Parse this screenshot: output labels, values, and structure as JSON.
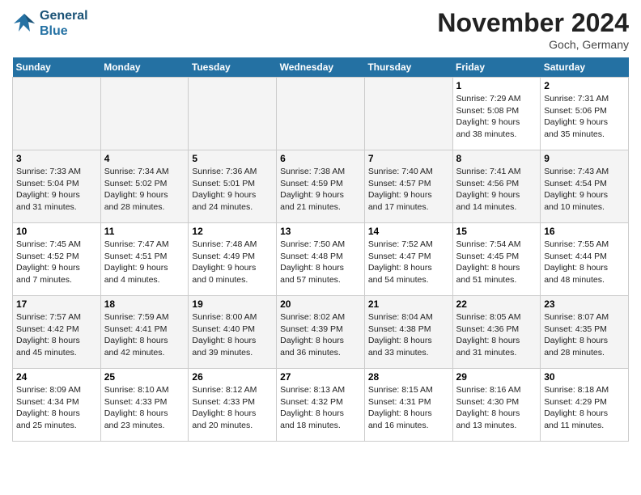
{
  "header": {
    "logo_line1": "General",
    "logo_line2": "Blue",
    "month": "November 2024",
    "location": "Goch, Germany"
  },
  "weekdays": [
    "Sunday",
    "Monday",
    "Tuesday",
    "Wednesday",
    "Thursday",
    "Friday",
    "Saturday"
  ],
  "weeks": [
    [
      {
        "day": "",
        "info": ""
      },
      {
        "day": "",
        "info": ""
      },
      {
        "day": "",
        "info": ""
      },
      {
        "day": "",
        "info": ""
      },
      {
        "day": "",
        "info": ""
      },
      {
        "day": "1",
        "info": "Sunrise: 7:29 AM\nSunset: 5:08 PM\nDaylight: 9 hours\nand 38 minutes."
      },
      {
        "day": "2",
        "info": "Sunrise: 7:31 AM\nSunset: 5:06 PM\nDaylight: 9 hours\nand 35 minutes."
      }
    ],
    [
      {
        "day": "3",
        "info": "Sunrise: 7:33 AM\nSunset: 5:04 PM\nDaylight: 9 hours\nand 31 minutes."
      },
      {
        "day": "4",
        "info": "Sunrise: 7:34 AM\nSunset: 5:02 PM\nDaylight: 9 hours\nand 28 minutes."
      },
      {
        "day": "5",
        "info": "Sunrise: 7:36 AM\nSunset: 5:01 PM\nDaylight: 9 hours\nand 24 minutes."
      },
      {
        "day": "6",
        "info": "Sunrise: 7:38 AM\nSunset: 4:59 PM\nDaylight: 9 hours\nand 21 minutes."
      },
      {
        "day": "7",
        "info": "Sunrise: 7:40 AM\nSunset: 4:57 PM\nDaylight: 9 hours\nand 17 minutes."
      },
      {
        "day": "8",
        "info": "Sunrise: 7:41 AM\nSunset: 4:56 PM\nDaylight: 9 hours\nand 14 minutes."
      },
      {
        "day": "9",
        "info": "Sunrise: 7:43 AM\nSunset: 4:54 PM\nDaylight: 9 hours\nand 10 minutes."
      }
    ],
    [
      {
        "day": "10",
        "info": "Sunrise: 7:45 AM\nSunset: 4:52 PM\nDaylight: 9 hours\nand 7 minutes."
      },
      {
        "day": "11",
        "info": "Sunrise: 7:47 AM\nSunset: 4:51 PM\nDaylight: 9 hours\nand 4 minutes."
      },
      {
        "day": "12",
        "info": "Sunrise: 7:48 AM\nSunset: 4:49 PM\nDaylight: 9 hours\nand 0 minutes."
      },
      {
        "day": "13",
        "info": "Sunrise: 7:50 AM\nSunset: 4:48 PM\nDaylight: 8 hours\nand 57 minutes."
      },
      {
        "day": "14",
        "info": "Sunrise: 7:52 AM\nSunset: 4:47 PM\nDaylight: 8 hours\nand 54 minutes."
      },
      {
        "day": "15",
        "info": "Sunrise: 7:54 AM\nSunset: 4:45 PM\nDaylight: 8 hours\nand 51 minutes."
      },
      {
        "day": "16",
        "info": "Sunrise: 7:55 AM\nSunset: 4:44 PM\nDaylight: 8 hours\nand 48 minutes."
      }
    ],
    [
      {
        "day": "17",
        "info": "Sunrise: 7:57 AM\nSunset: 4:42 PM\nDaylight: 8 hours\nand 45 minutes."
      },
      {
        "day": "18",
        "info": "Sunrise: 7:59 AM\nSunset: 4:41 PM\nDaylight: 8 hours\nand 42 minutes."
      },
      {
        "day": "19",
        "info": "Sunrise: 8:00 AM\nSunset: 4:40 PM\nDaylight: 8 hours\nand 39 minutes."
      },
      {
        "day": "20",
        "info": "Sunrise: 8:02 AM\nSunset: 4:39 PM\nDaylight: 8 hours\nand 36 minutes."
      },
      {
        "day": "21",
        "info": "Sunrise: 8:04 AM\nSunset: 4:38 PM\nDaylight: 8 hours\nand 33 minutes."
      },
      {
        "day": "22",
        "info": "Sunrise: 8:05 AM\nSunset: 4:36 PM\nDaylight: 8 hours\nand 31 minutes."
      },
      {
        "day": "23",
        "info": "Sunrise: 8:07 AM\nSunset: 4:35 PM\nDaylight: 8 hours\nand 28 minutes."
      }
    ],
    [
      {
        "day": "24",
        "info": "Sunrise: 8:09 AM\nSunset: 4:34 PM\nDaylight: 8 hours\nand 25 minutes."
      },
      {
        "day": "25",
        "info": "Sunrise: 8:10 AM\nSunset: 4:33 PM\nDaylight: 8 hours\nand 23 minutes."
      },
      {
        "day": "26",
        "info": "Sunrise: 8:12 AM\nSunset: 4:33 PM\nDaylight: 8 hours\nand 20 minutes."
      },
      {
        "day": "27",
        "info": "Sunrise: 8:13 AM\nSunset: 4:32 PM\nDaylight: 8 hours\nand 18 minutes."
      },
      {
        "day": "28",
        "info": "Sunrise: 8:15 AM\nSunset: 4:31 PM\nDaylight: 8 hours\nand 16 minutes."
      },
      {
        "day": "29",
        "info": "Sunrise: 8:16 AM\nSunset: 4:30 PM\nDaylight: 8 hours\nand 13 minutes."
      },
      {
        "day": "30",
        "info": "Sunrise: 8:18 AM\nSunset: 4:29 PM\nDaylight: 8 hours\nand 11 minutes."
      }
    ]
  ]
}
